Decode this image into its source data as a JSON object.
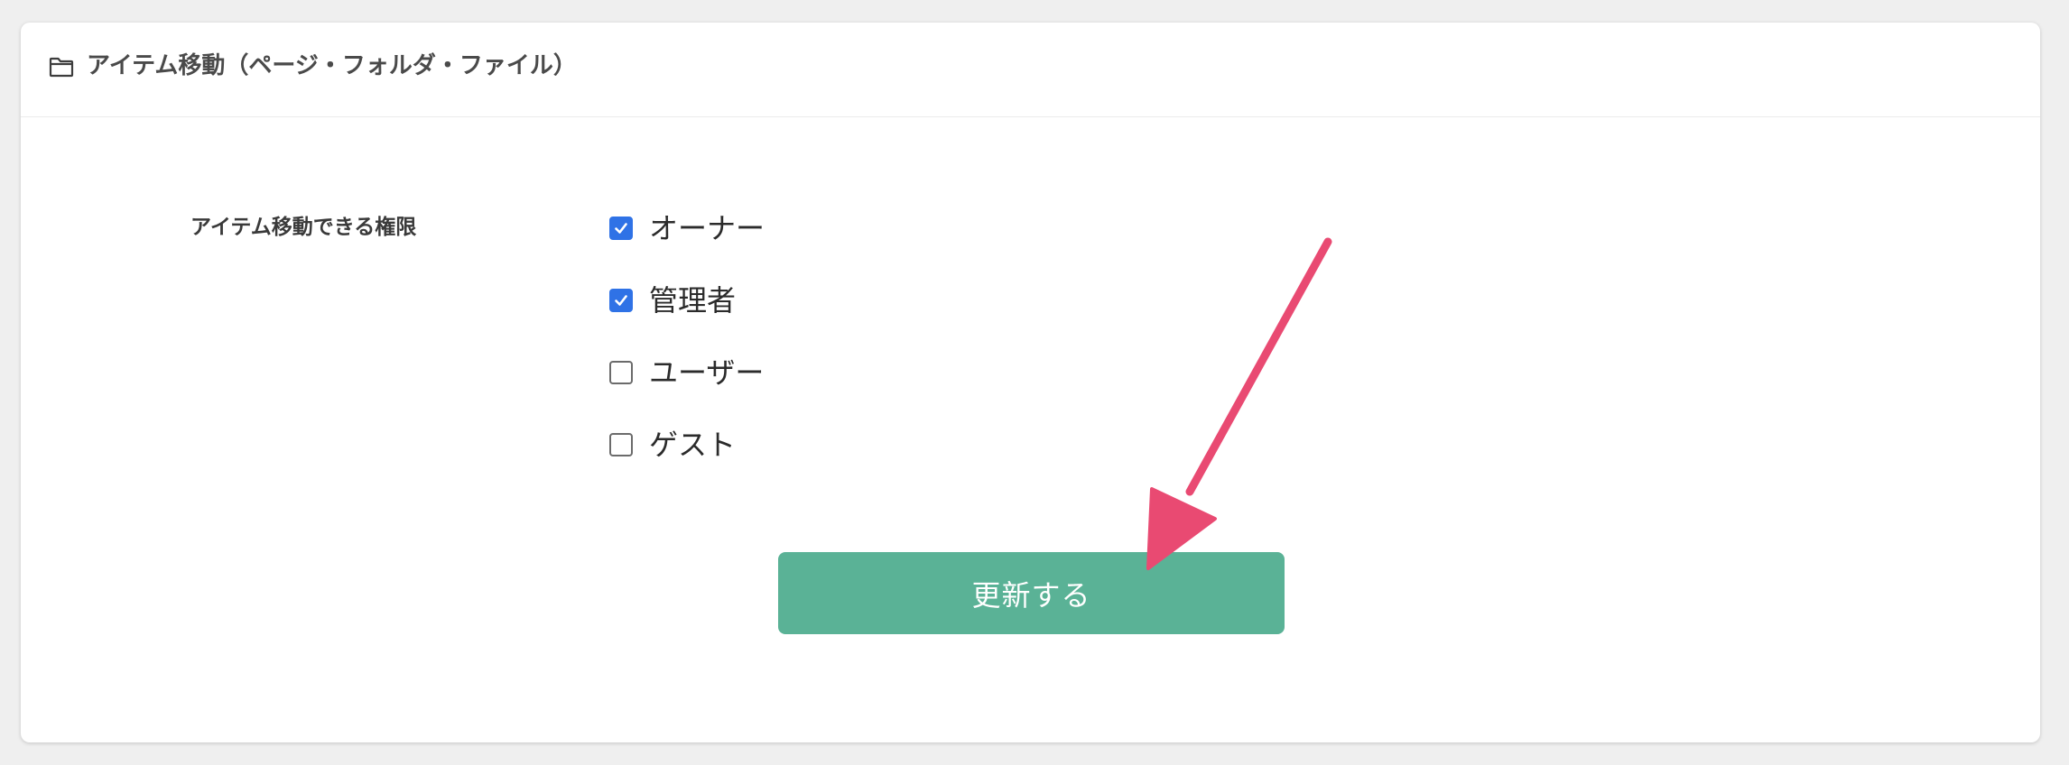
{
  "header": {
    "icon": "folder-icon",
    "title": "アイテム移動（ページ・フォルダ・ファイル）"
  },
  "form": {
    "permission_label": "アイテム移動できる権限",
    "options": [
      {
        "label": "オーナー",
        "checked": true
      },
      {
        "label": "管理者",
        "checked": true
      },
      {
        "label": "ユーザー",
        "checked": false
      },
      {
        "label": "ゲスト",
        "checked": false
      }
    ],
    "submit_label": "更新する"
  },
  "colors": {
    "page_background": "#efefef",
    "card_background": "#ffffff",
    "checkbox_checked": "#2f72e6",
    "submit_button": "#5ab296",
    "annotation_arrow": "#e94a72"
  },
  "annotation": {
    "type": "arrow",
    "target": "submit-button"
  }
}
